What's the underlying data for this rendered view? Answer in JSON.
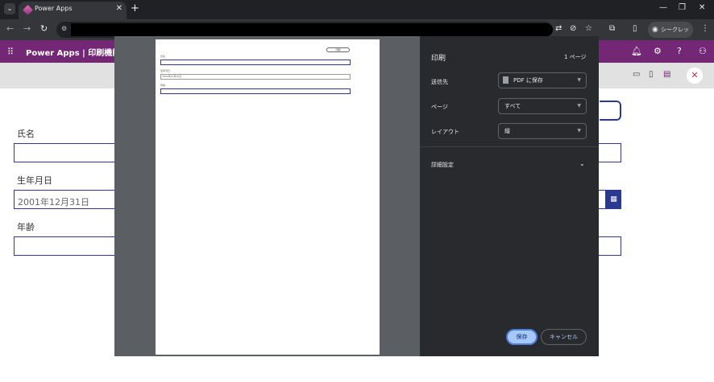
{
  "browser": {
    "tab_title": "Power Apps",
    "tab_close": "✕",
    "new_tab": "+",
    "incognito_label": "シークレット",
    "window_controls": [
      "—",
      "❐",
      "✕"
    ]
  },
  "app": {
    "title": "Power Apps  |  印刷機能検..."
  },
  "form": {
    "name_label": "氏名",
    "name_value": "",
    "birth_label": "生年月日",
    "birth_value": "2001年12月31日",
    "age_label": "年齢",
    "age_value": ""
  },
  "print_dialog": {
    "title": "印刷",
    "page_count": "1 ページ",
    "destination_label": "送信先",
    "destination_value": "PDF に保存",
    "pages_label": "ページ",
    "pages_value": "すべて",
    "layout_label": "レイアウト",
    "layout_value": "縦",
    "more_settings_label": "詳細設定",
    "save_label": "保存",
    "cancel_label": "キャンセル"
  },
  "preview": {
    "button_label": "印刷",
    "name_label": "氏名",
    "birth_label": "生年月日",
    "birth_value": "2001年12月31日",
    "age_label": "年齢"
  },
  "colors": {
    "app_header": "#742774",
    "field_border": "#2b3990",
    "dialog_panel": "#292a2d",
    "save_button": "#a8c7fa"
  }
}
